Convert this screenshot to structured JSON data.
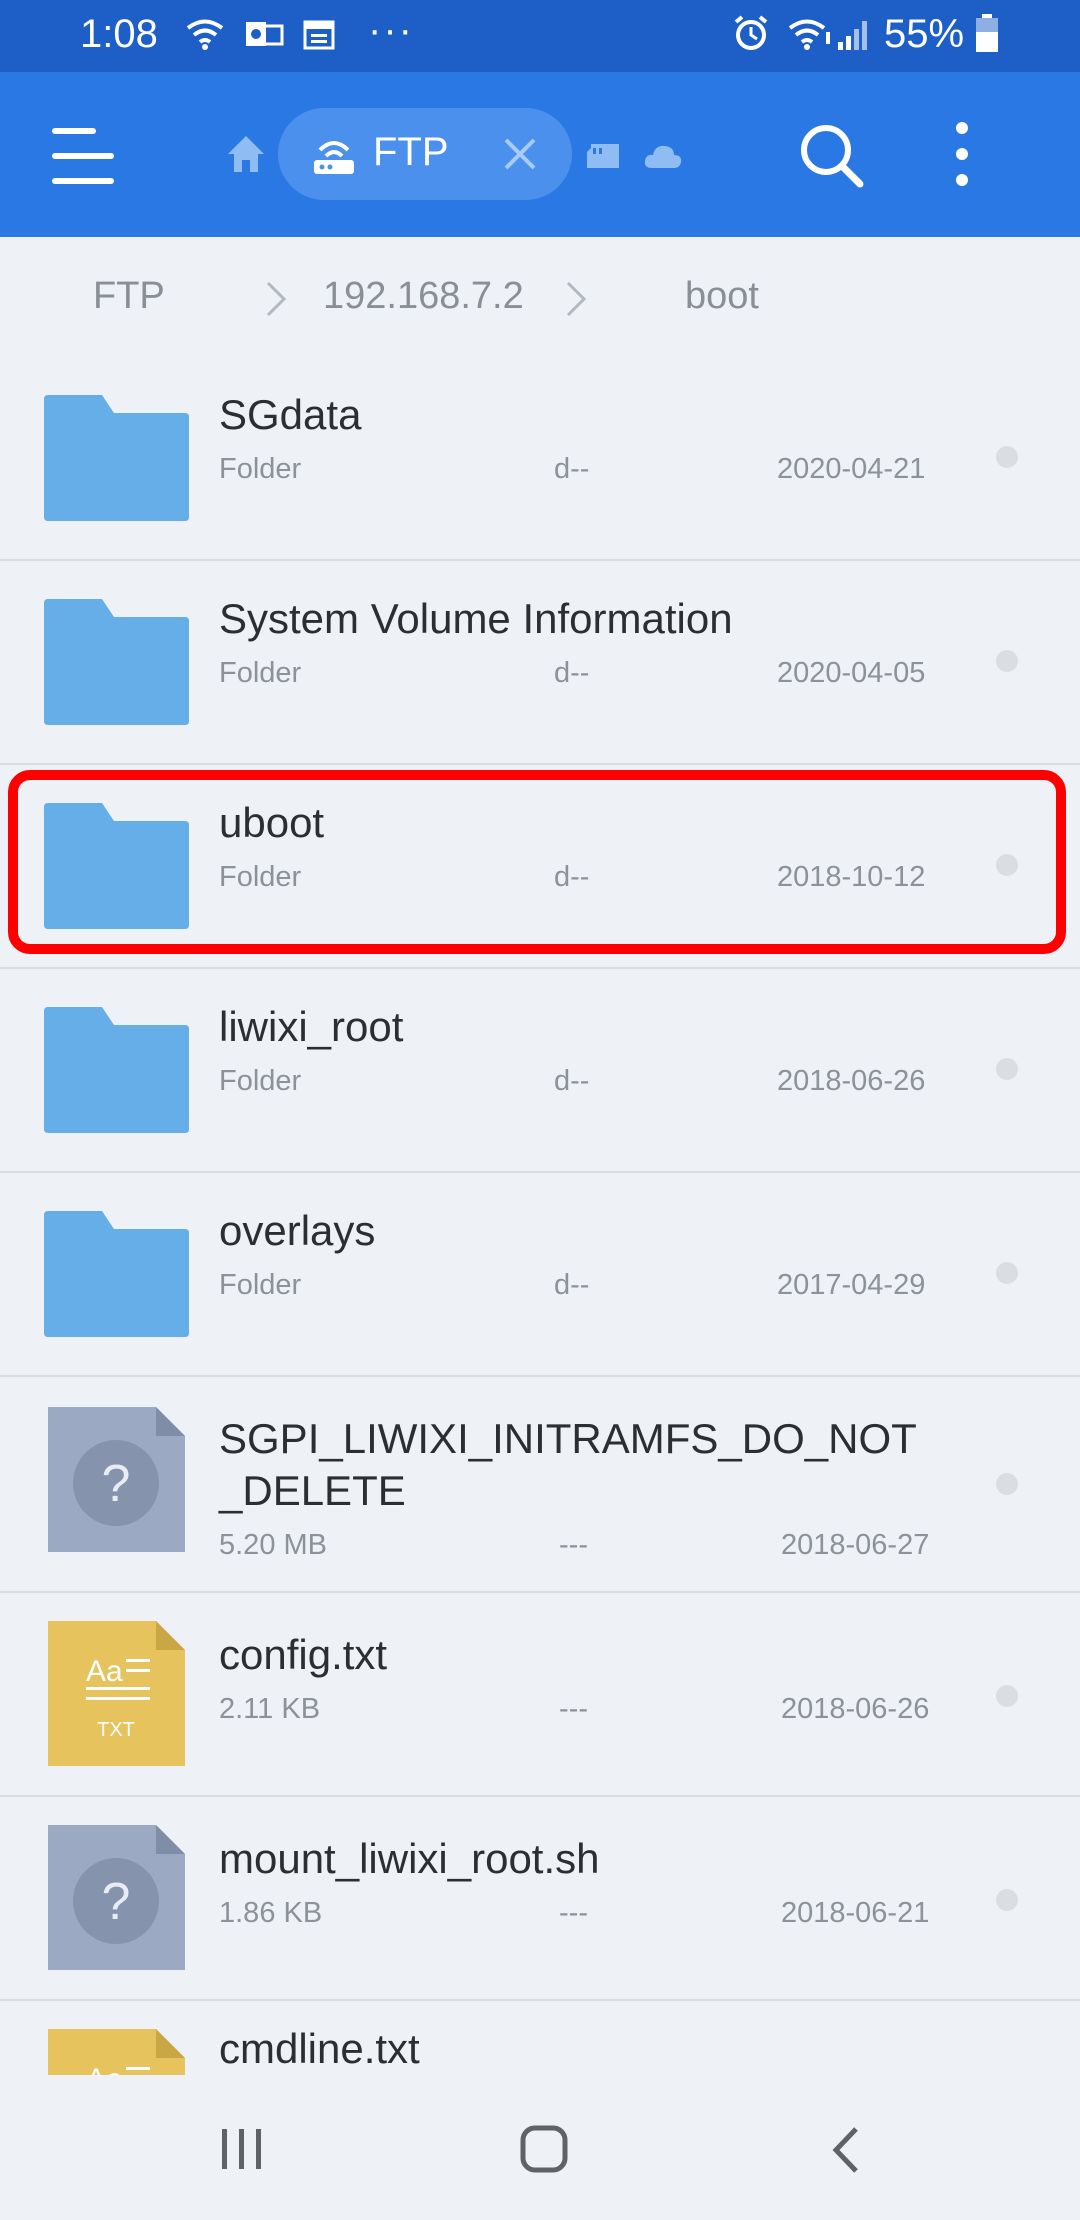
{
  "status_bar": {
    "time": "1:08",
    "battery": "55%",
    "icons": [
      "wifi-icon",
      "outlook-icon",
      "calendar-icon",
      "more-notifications-icon",
      "alarm-icon",
      "wifi-signal-icon",
      "cell-signal-icon",
      "battery-icon"
    ],
    "more": "···"
  },
  "app_bar": {
    "tab_label": "FTP",
    "icons": [
      "menu-icon",
      "home-icon",
      "router-icon",
      "close-icon",
      "sd-card-icon",
      "cloud-icon",
      "search-icon",
      "more-vert-icon"
    ]
  },
  "breadcrumb": {
    "items": [
      "FTP",
      "192.168.7.2",
      "boot"
    ]
  },
  "files": [
    {
      "name": "SGdata",
      "type": "Folder",
      "perm": "d--",
      "date": "2020-04-21",
      "icon": "folder-icon"
    },
    {
      "name": "System Volume Information",
      "type": "Folder",
      "perm": "d--",
      "date": "2020-04-05",
      "icon": "folder-icon"
    },
    {
      "name": "uboot",
      "type": "Folder",
      "perm": "d--",
      "date": "2018-10-12",
      "icon": "folder-icon",
      "highlighted": true
    },
    {
      "name": "liwixi_root",
      "type": "Folder",
      "perm": "d--",
      "date": "2018-06-26",
      "icon": "folder-icon"
    },
    {
      "name": "overlays",
      "type": "Folder",
      "perm": "d--",
      "date": "2017-04-29",
      "icon": "folder-icon"
    },
    {
      "name": "SGPI_LIWIXI_INITRAMFS_DO_NOT_DELETE",
      "type": "5.20 MB",
      "perm": "---",
      "date": "2018-06-27",
      "icon": "unknown-file-icon"
    },
    {
      "name": "config.txt",
      "type": "2.11 KB",
      "perm": "---",
      "date": "2018-06-26",
      "icon": "text-file-icon"
    },
    {
      "name": "mount_liwixi_root.sh",
      "type": "1.86 KB",
      "perm": "---",
      "date": "2018-06-21",
      "icon": "unknown-file-icon"
    },
    {
      "name": "cmdline.txt",
      "icon": "text-file-icon"
    }
  ],
  "txt_badge": "TXT",
  "txt_glyph": "Aa",
  "unknown_glyph": "?",
  "colors": {
    "status_bar": "#1d5fc6",
    "app_bar": "#2a78e4",
    "chip": "#4b90ec",
    "folder": "#65aee8",
    "unknown_file": "#9ba9c2",
    "text_file": "#e6c35c",
    "highlight": "#ff0000",
    "background": "#eef1f5"
  }
}
